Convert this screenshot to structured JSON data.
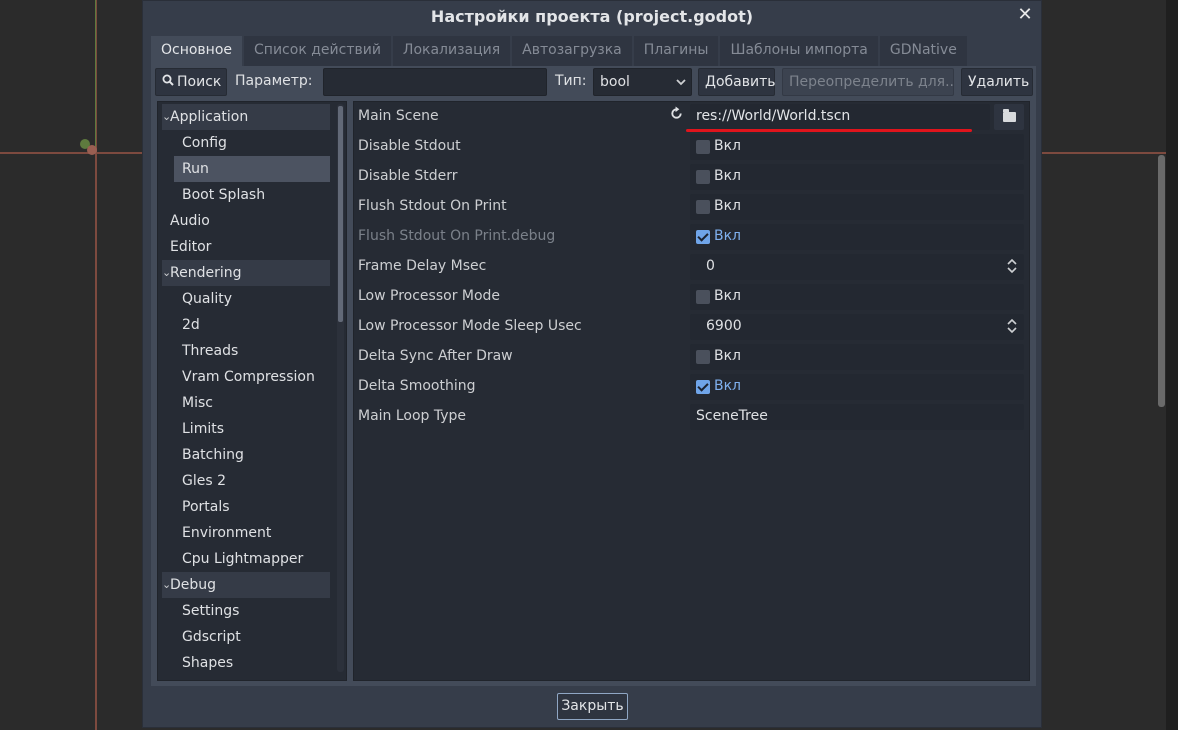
{
  "dialog": {
    "title": "Настройки проекта (project.godot)",
    "close_glyph": "✕"
  },
  "tabs": [
    {
      "label": "Основное",
      "active": true
    },
    {
      "label": "Список действий"
    },
    {
      "label": "Локализация"
    },
    {
      "label": "Автозагрузка"
    },
    {
      "label": "Плагины"
    },
    {
      "label": "Шаблоны импорта"
    },
    {
      "label": "GDNative"
    }
  ],
  "toolbar": {
    "search_label": "Поиск",
    "param_label": "Параметр:",
    "param_value": "",
    "type_label": "Тип:",
    "type_value": "bool",
    "add_label": "Добавить",
    "override_label": "Переопределить для...",
    "delete_label": "Удалить"
  },
  "tree": [
    {
      "label": "Application",
      "section": true
    },
    {
      "label": "Config"
    },
    {
      "label": "Run",
      "selected": true
    },
    {
      "label": "Boot Splash"
    },
    {
      "label": "Audio",
      "top": true
    },
    {
      "label": "Editor",
      "top": true
    },
    {
      "label": "Rendering",
      "section": true
    },
    {
      "label": "Quality"
    },
    {
      "label": "2d"
    },
    {
      "label": "Threads"
    },
    {
      "label": "Vram Compression"
    },
    {
      "label": "Misc"
    },
    {
      "label": "Limits"
    },
    {
      "label": "Batching"
    },
    {
      "label": "Gles 2"
    },
    {
      "label": "Portals"
    },
    {
      "label": "Environment"
    },
    {
      "label": "Cpu Lightmapper"
    },
    {
      "label": "Debug",
      "section": true
    },
    {
      "label": "Settings"
    },
    {
      "label": "Gdscript"
    },
    {
      "label": "Shapes"
    }
  ],
  "properties": {
    "main_scene": {
      "name": "Main Scene",
      "value": "res://World/World.tscn"
    },
    "disable_stdout": {
      "name": "Disable Stdout",
      "label": "Вкл",
      "checked": false
    },
    "disable_stderr": {
      "name": "Disable Stderr",
      "label": "Вкл",
      "checked": false
    },
    "flush_stdout": {
      "name": "Flush Stdout On Print",
      "label": "Вкл",
      "checked": false
    },
    "flush_stdout_debug": {
      "name": "Flush Stdout On Print.debug",
      "label": "Вкл",
      "checked": true
    },
    "frame_delay": {
      "name": "Frame Delay Msec",
      "value": "0"
    },
    "low_processor": {
      "name": "Low Processor Mode",
      "label": "Вкл",
      "checked": false
    },
    "low_processor_sleep": {
      "name": "Low Processor Mode Sleep Usec",
      "value": "6900"
    },
    "delta_sync": {
      "name": "Delta Sync After Draw",
      "label": "Вкл",
      "checked": false
    },
    "delta_smoothing": {
      "name": "Delta Smoothing",
      "label": "Вкл",
      "checked": true
    },
    "main_loop": {
      "name": "Main Loop Type",
      "value": "SceneTree"
    }
  },
  "footer": {
    "close_label": "Закрыть"
  },
  "icons": {
    "search": "search-icon",
    "revert": "revert-icon",
    "folder": "folder-icon",
    "dropdown": "chevron-down-icon",
    "spinner": "spinner-icon"
  },
  "colors": {
    "accent": "#6fa4e8",
    "underline": "#e0141c",
    "panel": "#434b59"
  }
}
